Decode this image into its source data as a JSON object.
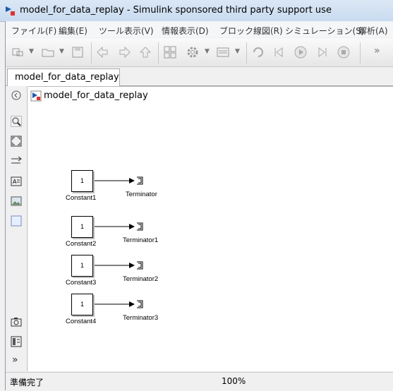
{
  "window": {
    "title": "model_for_data_replay - Simulink sponsored third party support use"
  },
  "menubar": {
    "items": [
      "ファイル(F)",
      "編集(E)",
      "ツール表示(V)",
      "情報表示(D)",
      "ブロック線図(R)",
      "シミュレーション(S)",
      "解析(A)"
    ]
  },
  "tabs": [
    {
      "label": "model_for_data_replay"
    }
  ],
  "breadcrumb": {
    "label": "model_for_data_replay"
  },
  "toolbar": {
    "icons": [
      "new-model-icon",
      "open-icon",
      "save-icon",
      "back-icon",
      "forward-icon",
      "up-icon",
      "library-browser-icon",
      "settings-gear-icon",
      "model-explorer-icon",
      "update-diagram-icon",
      "step-back-icon",
      "run-icon",
      "step-forward-icon",
      "stop-icon",
      "more-icon"
    ]
  },
  "palette": {
    "icons": [
      "hide-browser-icon",
      "zoom-in-icon",
      "fit-view-icon",
      "signal-lines-icon",
      "annotation-icon",
      "image-icon",
      "area-icon",
      "screenshot-icon",
      "model-data-icon",
      "expand-icon"
    ]
  },
  "blocks": [
    {
      "value": "1",
      "block_label": "Constant1",
      "terminator_label": "Terminator"
    },
    {
      "value": "1",
      "block_label": "Constant2",
      "terminator_label": "Terminator1"
    },
    {
      "value": "1",
      "block_label": "Constant3",
      "terminator_label": "Terminator2"
    },
    {
      "value": "1",
      "block_label": "Constant4",
      "terminator_label": "Terminator3"
    }
  ],
  "statusbar": {
    "status": "準備完了",
    "zoom": "100%"
  },
  "colors": {
    "titlebar": "#c9dbf0",
    "canvas": "#ffffff",
    "accent": "#1e5aa8"
  }
}
